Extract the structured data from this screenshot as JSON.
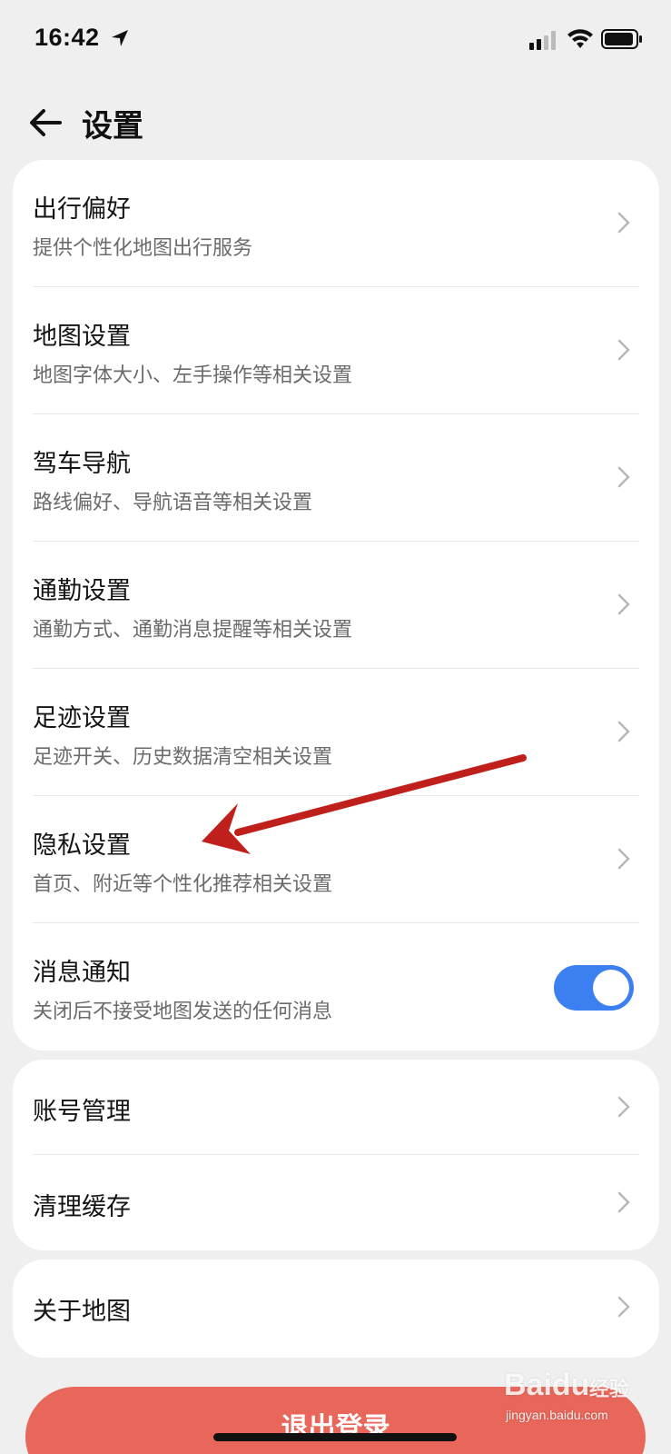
{
  "status_bar": {
    "time": "16:42"
  },
  "header": {
    "title": "设置"
  },
  "cards": {
    "main": [
      {
        "title": "出行偏好",
        "subtitle": "提供个性化地图出行服务"
      },
      {
        "title": "地图设置",
        "subtitle": "地图字体大小、左手操作等相关设置"
      },
      {
        "title": "驾车导航",
        "subtitle": "路线偏好、导航语音等相关设置"
      },
      {
        "title": "通勤设置",
        "subtitle": "通勤方式、通勤消息提醒等相关设置"
      },
      {
        "title": "足迹设置",
        "subtitle": "足迹开关、历史数据清空相关设置"
      },
      {
        "title": "隐私设置",
        "subtitle": "首页、附近等个性化推荐相关设置"
      },
      {
        "title": "消息通知",
        "subtitle": "关闭后不接受地图发送的任何消息",
        "toggle_on": true
      }
    ],
    "account": [
      {
        "title": "账号管理"
      },
      {
        "title": "清理缓存"
      }
    ],
    "about": [
      {
        "title": "关于地图"
      }
    ]
  },
  "logout_label": "退出登录",
  "watermark": {
    "logo": "Baidu",
    "brand": "经验",
    "url": "jingyan.baidu.com"
  },
  "colors": {
    "toggle_on": "#3b7ff0",
    "logout": "#e8665a",
    "annotation_arrow": "#c0201c"
  }
}
